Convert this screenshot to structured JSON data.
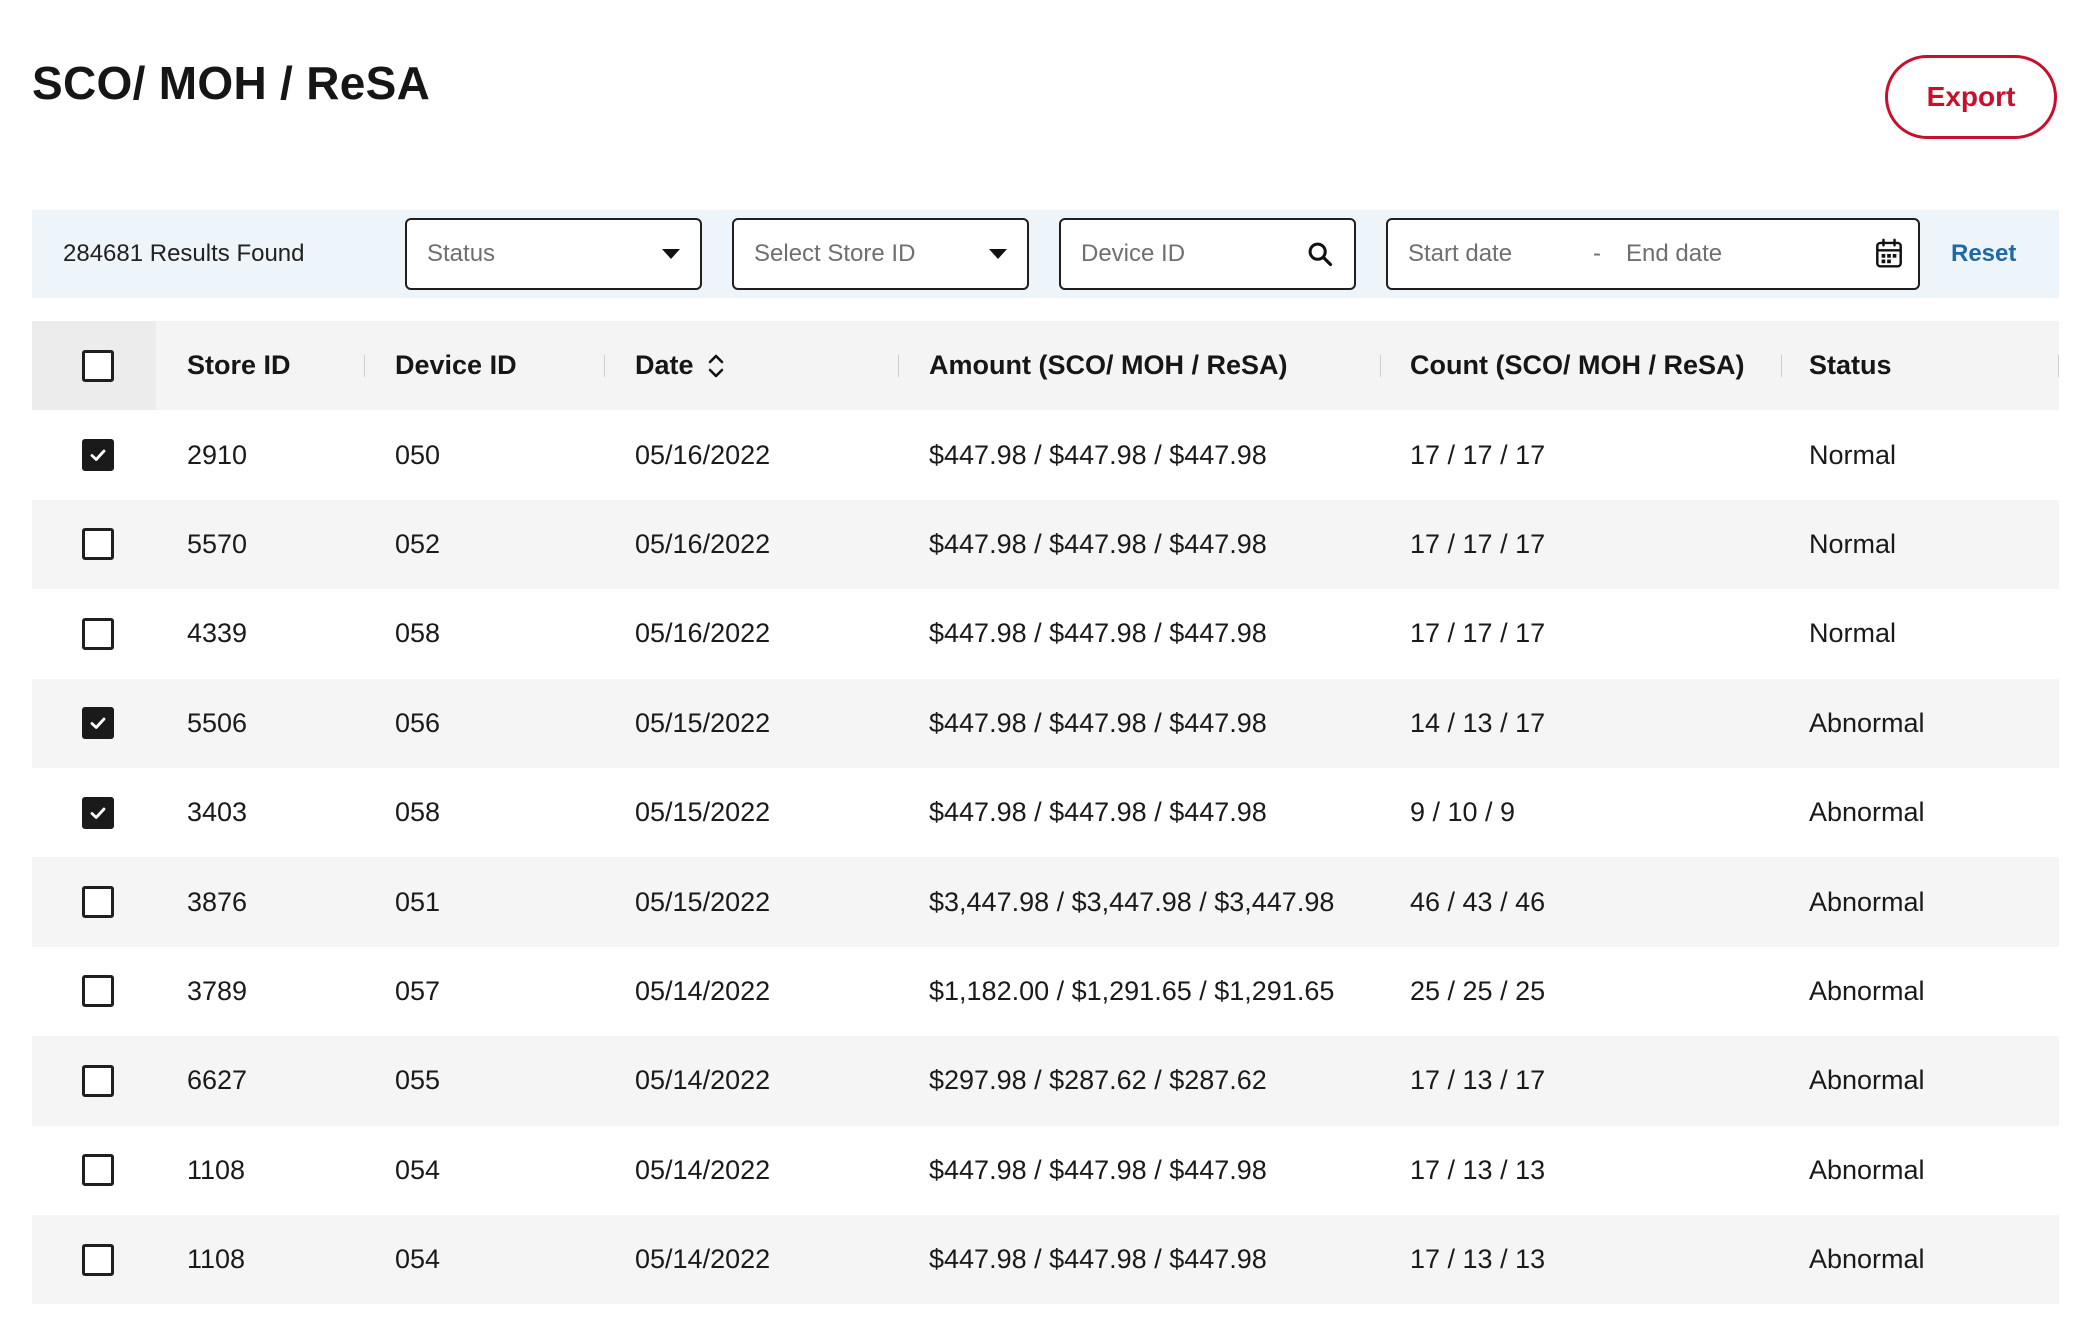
{
  "page": {
    "title": "SCO/ MOH / ReSA"
  },
  "header": {
    "export_label": "Export"
  },
  "filters": {
    "results_text": "284681 Results Found",
    "status_placeholder": "Status",
    "store_placeholder": "Select Store ID",
    "device_placeholder": "Device ID",
    "start_date_placeholder": "Start date",
    "date_separator": "-",
    "end_date_placeholder": "End date",
    "reset_label": "Reset",
    "icons": [
      "caret-down-icon",
      "search-icon",
      "calendar-icon"
    ]
  },
  "table": {
    "select_all_checked": false,
    "columns": {
      "store_id": "Store ID",
      "device_id": "Device ID",
      "date": "Date",
      "amount": "Amount (SCO/ MOH / ReSA)",
      "count": "Count (SCO/ MOH / ReSA)",
      "status": "Status"
    },
    "sortable_column": "Date",
    "rows": [
      {
        "checked": true,
        "store_id": "2910",
        "device_id": "050",
        "date": "05/16/2022",
        "amount": "$447.98 / $447.98 / $447.98",
        "count": "17 / 17 / 17",
        "status": "Normal"
      },
      {
        "checked": false,
        "store_id": "5570",
        "device_id": "052",
        "date": "05/16/2022",
        "amount": "$447.98 / $447.98 / $447.98",
        "count": "17 / 17 / 17",
        "status": "Normal"
      },
      {
        "checked": false,
        "store_id": "4339",
        "device_id": "058",
        "date": "05/16/2022",
        "amount": "$447.98 / $447.98 / $447.98",
        "count": "17 / 17 / 17",
        "status": "Normal"
      },
      {
        "checked": true,
        "store_id": "5506",
        "device_id": "056",
        "date": "05/15/2022",
        "amount": "$447.98 / $447.98 / $447.98",
        "count": "14 / 13 / 17",
        "status": "Abnormal"
      },
      {
        "checked": true,
        "store_id": "3403",
        "device_id": "058",
        "date": "05/15/2022",
        "amount": "$447.98 / $447.98 / $447.98",
        "count": "9 / 10 / 9",
        "status": "Abnormal"
      },
      {
        "checked": false,
        "store_id": "3876",
        "device_id": "051",
        "date": "05/15/2022",
        "amount": "$3,447.98 / $3,447.98 / $3,447.98",
        "count": "46 / 43 / 46",
        "status": "Abnormal"
      },
      {
        "checked": false,
        "store_id": "3789",
        "device_id": "057",
        "date": "05/14/2022",
        "amount": "$1,182.00 / $1,291.65 / $1,291.65",
        "count": "25 / 25 / 25",
        "status": "Abnormal"
      },
      {
        "checked": false,
        "store_id": "6627",
        "device_id": "055",
        "date": "05/14/2022",
        "amount": "$297.98 / $287.62 / $287.62",
        "count": "17 / 13 / 17",
        "status": "Abnormal"
      },
      {
        "checked": false,
        "store_id": "1108",
        "device_id": "054",
        "date": "05/14/2022",
        "amount": "$447.98 / $447.98 / $447.98",
        "count": "17 / 13 / 13",
        "status": "Abnormal"
      },
      {
        "checked": false,
        "store_id": "1108",
        "device_id": "054",
        "date": "05/14/2022",
        "amount": "$447.98 / $447.98 / $447.98",
        "count": "17 / 13 / 13",
        "status": "Abnormal"
      }
    ]
  },
  "colors": {
    "accent_red": "#c8102e",
    "link_blue": "#1f6aa5",
    "filter_bar_bg": "#edf5fa",
    "row_alt_bg": "#f5f5f5"
  }
}
